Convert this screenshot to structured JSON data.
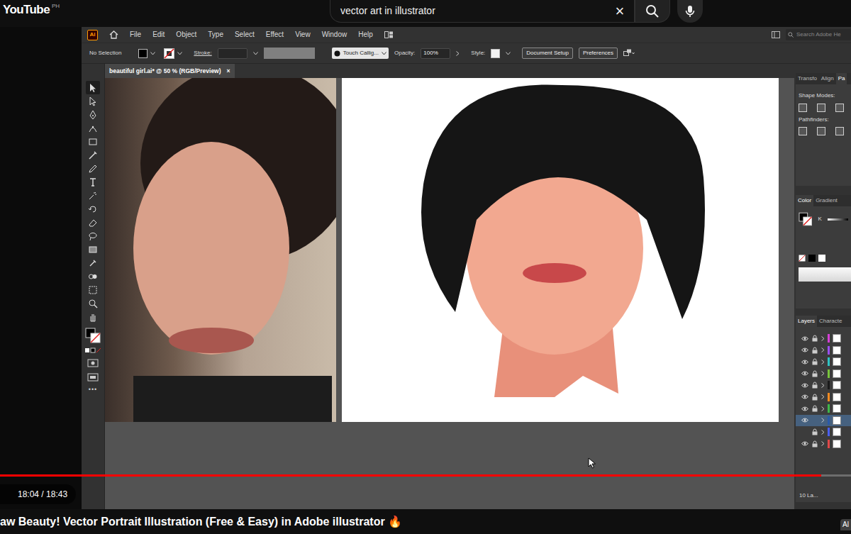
{
  "youtube": {
    "logo": "YouTube",
    "region": "PH",
    "search": {
      "value": "vector art in illustrator",
      "clear": "×"
    }
  },
  "app": {
    "logo": "Ai",
    "menu": [
      "File",
      "Edit",
      "Object",
      "Type",
      "Select",
      "Effect",
      "View",
      "Window",
      "Help"
    ],
    "search_placeholder": "Search Adobe He"
  },
  "control_bar": {
    "selection": "No Selection",
    "stroke_label": "Stroke:",
    "brush": "Touch Callig...",
    "opacity_label": "Opacity:",
    "opacity": "100%",
    "style_label": "Style:",
    "buttons": [
      "Document Setup",
      "Preferences"
    ]
  },
  "document_tab": {
    "title": "beautiful girl.ai* @ 50 % (RGB/Preview)",
    "close": "×"
  },
  "tools": [
    {
      "selected": true
    },
    {
      "selected": false
    },
    {
      "selected": false
    },
    {
      "selected": false
    },
    {
      "selected": false
    },
    {
      "selected": false
    },
    {
      "selected": false
    },
    {
      "selected": false
    },
    {
      "selected": false
    },
    {
      "selected": false
    },
    {
      "selected": false
    },
    {
      "selected": false
    },
    {
      "selected": false
    },
    {
      "selected": false
    },
    {
      "selected": false
    },
    {
      "selected": false
    },
    {
      "selected": false
    },
    {
      "selected": false
    }
  ],
  "more_tools": "•••",
  "panels": {
    "transform_tabs": [
      {
        "label": "Transfo",
        "selected": false
      },
      {
        "label": "Align",
        "selected": false
      },
      {
        "label": "Pa",
        "selected": true
      }
    ],
    "shape_modes": "Shape Modes:",
    "pathfinders": "Pathfinders:",
    "color_tabs": [
      {
        "label": "Color",
        "selected": true
      },
      {
        "label": "Gradient",
        "selected": false
      }
    ],
    "color_channel": "K",
    "layers_tabs": [
      {
        "label": "Layers",
        "selected": true
      },
      {
        "label": "Characte",
        "selected": false
      }
    ],
    "layers": [
      {
        "color": "#d63fd6",
        "visible": true,
        "locked": true,
        "selected": false
      },
      {
        "color": "#9b4ff0",
        "visible": true,
        "locked": true,
        "selected": false
      },
      {
        "color": "#2fc3c3",
        "visible": true,
        "locked": true,
        "selected": false
      },
      {
        "color": "#78c43c",
        "visible": true,
        "locked": true,
        "selected": false
      },
      {
        "color": "#1a1a1a",
        "visible": true,
        "locked": true,
        "selected": false
      },
      {
        "color": "#f08a20",
        "visible": true,
        "locked": true,
        "selected": false
      },
      {
        "color": "#3fb84a",
        "visible": true,
        "locked": true,
        "selected": false
      },
      {
        "color": "#2a5aa8",
        "visible": true,
        "locked": false,
        "selected": true
      },
      {
        "color": "#4a5ff0",
        "visible": false,
        "locked": true,
        "selected": false
      },
      {
        "color": "#e04848",
        "visible": true,
        "locked": true,
        "selected": false
      }
    ],
    "layers_footer": "10 La..."
  },
  "player": {
    "progress": 0.965,
    "time": "18:04 / 18:43"
  },
  "video_title": "aw Beauty! Vector Portrait Illustration (Free & Easy) in Adobe illustrator 🔥",
  "corner_button": "Al"
}
